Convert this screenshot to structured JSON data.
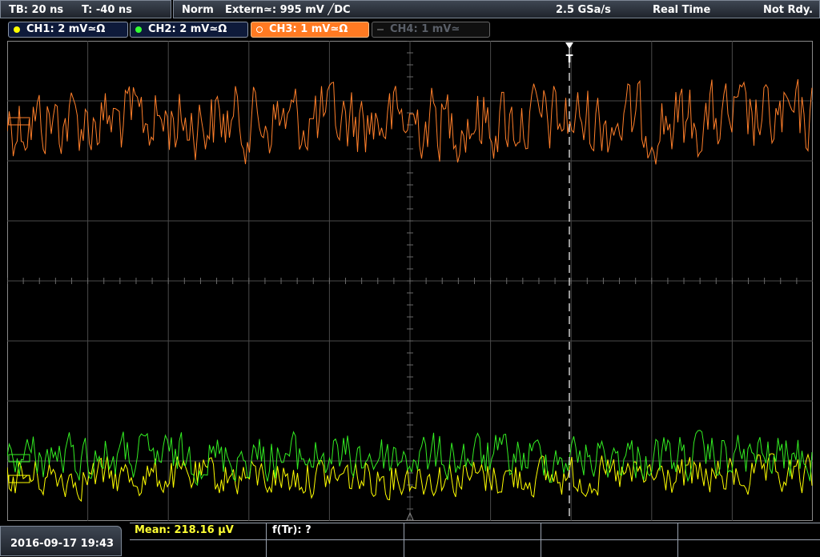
{
  "top_bar": {
    "timebase": "TB: 20 ns",
    "trigger_time": "T: -40 ns",
    "trigger_mode": "Norm",
    "trigger_source": "Extern≃: 995 mV ╱DC",
    "sample_rate": "2.5 GSa/s",
    "acq_mode": "Real Time",
    "status": "Not Rdy."
  },
  "channels": [
    {
      "label": "CH1: 2 mV≃Ω",
      "color": "#ffff00",
      "active": false
    },
    {
      "label": "CH2: 2 mV≃Ω",
      "color": "#33ff33",
      "active": false
    },
    {
      "label": "CH3: 1 mV≃Ω",
      "color": "#ff7a22",
      "active": true
    },
    {
      "label": "CH4: 1 mV≃",
      "color": "#555555",
      "active": false
    }
  ],
  "trigger_marker": "T",
  "bottom": {
    "datetime": "2016-09-17 19:43",
    "mean": "Mean: 218.16 µV",
    "ftr": "f(Tr): ?"
  },
  "waveform_colors": {
    "ch1": "#ffff00",
    "ch2": "#33ee22",
    "ch3": "#ff7f2a"
  }
}
